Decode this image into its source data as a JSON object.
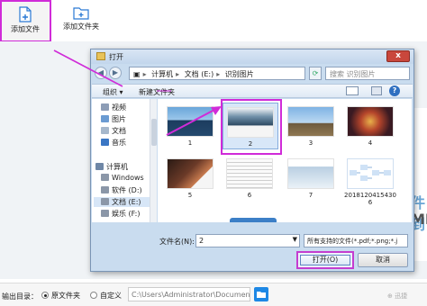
{
  "toolbar": {
    "add_file_label": "添加文件",
    "add_folder_label": "添加文件夹"
  },
  "dialog": {
    "title": "打开",
    "close_label": "x",
    "address": [
      "计算机",
      "文档 (E:)",
      "识别图片"
    ],
    "search_placeholder": "搜索 识别图片",
    "organize_label": "组织 ▾",
    "new_folder_label": "新建文件夹",
    "nav_items": [
      {
        "label": "视频",
        "icon": "video-icon",
        "color": "#8d9db6"
      },
      {
        "label": "图片",
        "icon": "picture-icon",
        "color": "#6b9bd2"
      },
      {
        "label": "文档",
        "icon": "document-icon",
        "color": "#a6b8cc"
      },
      {
        "label": "音乐",
        "icon": "music-icon",
        "color": "#3a76c4"
      },
      {
        "label": "计算机",
        "icon": "computer-icon",
        "color": "#6f87a6"
      },
      {
        "label": "Windows",
        "icon": "drive-icon",
        "color": "#8b97a8"
      },
      {
        "label": "软件 (D:)",
        "icon": "drive-icon",
        "color": "#8b97a8"
      },
      {
        "label": "文档 (E:)",
        "icon": "drive-icon",
        "color": "#8b97a8"
      },
      {
        "label": "娱乐 (F:)",
        "icon": "drive-icon",
        "color": "#8b97a8"
      }
    ],
    "files": [
      {
        "caption": "1",
        "icon": "image-thumbnail-icon"
      },
      {
        "caption": "2",
        "icon": "image-thumbnail-icon"
      },
      {
        "caption": "3",
        "icon": "image-thumbnail-icon"
      },
      {
        "caption": "4",
        "icon": "image-thumbnail-icon"
      },
      {
        "caption": "5",
        "icon": "image-thumbnail-icon"
      },
      {
        "caption": "6",
        "icon": "image-thumbnail-icon"
      },
      {
        "caption": "7",
        "icon": "image-thumbnail-icon"
      },
      {
        "caption": "2018120415430\n6",
        "icon": "image-thumbnail-icon"
      }
    ],
    "filename_label": "文件名(N):",
    "filename_value": "2",
    "filter_value": "所有支持的文件(*.pdf;*.png;*.j",
    "open_label": "打开(O)",
    "cancel_label": "取消"
  },
  "output": {
    "label": "输出目录：",
    "option1": "原文件夹",
    "option2": "自定义",
    "path_value": "C:\\Users\\Administrator\\Documents",
    "watermark": "⊕ 迅捷"
  },
  "side_text": {
    "line1": "件到",
    "line2": "MP"
  },
  "colors": {
    "highlight": "#d02bd8",
    "accent": "#1e88e5"
  }
}
